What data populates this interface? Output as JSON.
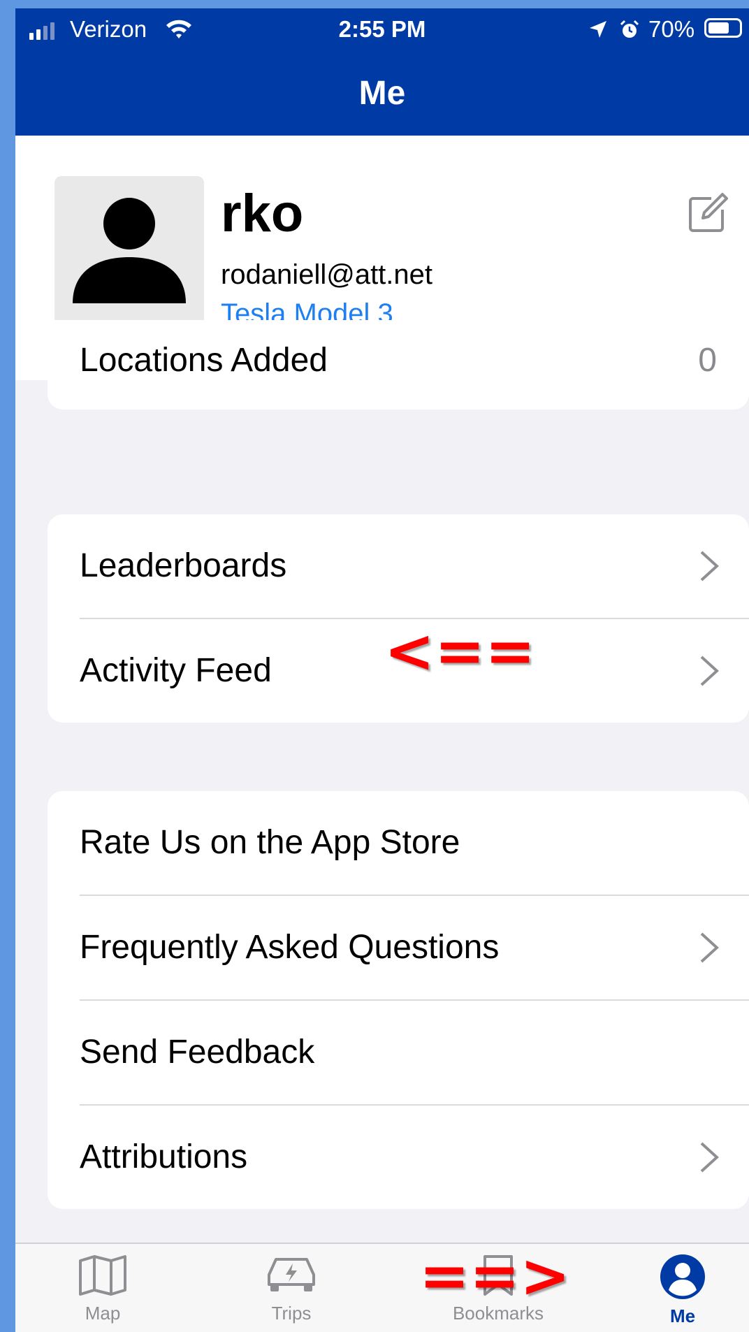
{
  "status_bar": {
    "carrier": "Verizon",
    "time": "2:55 PM",
    "battery_percent_text": "70%",
    "battery_level": 0.7
  },
  "header": {
    "title": "Me"
  },
  "profile": {
    "name": "rko",
    "email": "rodaniell@att.net",
    "vehicle": "Tesla Model 3"
  },
  "stats": {
    "label": "Locations Added",
    "value": "0"
  },
  "community": [
    {
      "label": "Leaderboards",
      "chevron": true
    },
    {
      "label": "Activity Feed",
      "chevron": true
    }
  ],
  "support": [
    {
      "label": "Rate Us on the App Store",
      "chevron": false
    },
    {
      "label": "Frequently Asked Questions",
      "chevron": true
    },
    {
      "label": "Send Feedback",
      "chevron": false
    },
    {
      "label": "Attributions",
      "chevron": true
    }
  ],
  "tabs": [
    {
      "label": "Map",
      "icon": "map-icon"
    },
    {
      "label": "Trips",
      "icon": "car-charging-icon"
    },
    {
      "label": "Bookmarks",
      "icon": "bookmark-icon"
    },
    {
      "label": "Me",
      "icon": "person-icon",
      "active": true
    }
  ],
  "annotations": {
    "arrow_left": "<==",
    "arrow_right": "==>"
  },
  "colors": {
    "header": "#003ba5",
    "accent_link": "#1f7ff0",
    "annotation": "#ff0000",
    "background_frame": "#5f97e0"
  }
}
